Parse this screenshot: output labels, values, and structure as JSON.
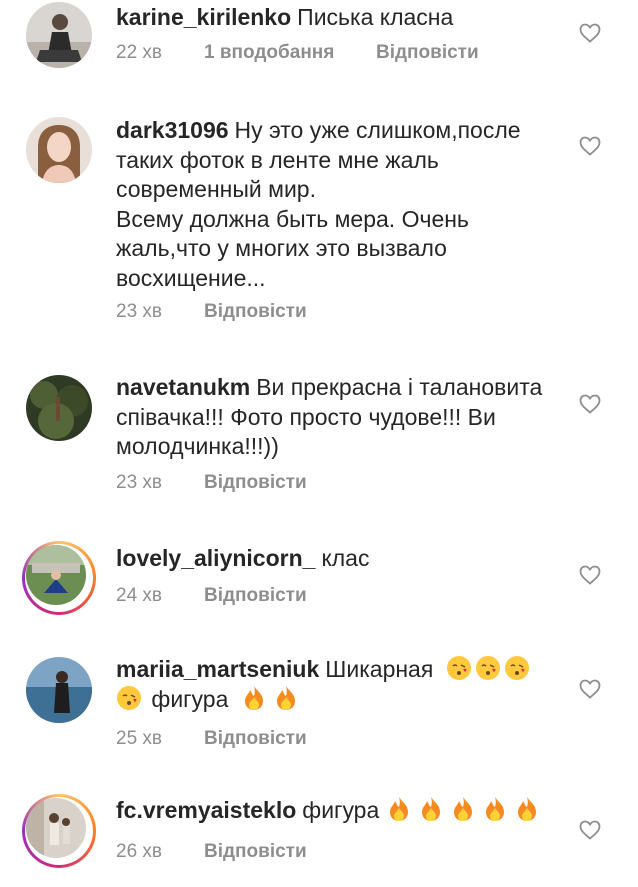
{
  "comments": [
    {
      "username": "karine_kirilenko",
      "text": "Писька класна",
      "time": "22 хв",
      "likes": "1 вподобання",
      "reply": "Відповісти",
      "avatar_icon": "avatar-photo-icon",
      "story_ring": false
    },
    {
      "username": "dark31096",
      "text": "Ну это уже слишком,после таких фоток в ленте мне жаль современный мир.",
      "text2": "Всему должна быть мера. Очень жаль,что у многих это вызвало восхищение...",
      "time": "23 хв",
      "reply": "Відповісти",
      "avatar_icon": "avatar-photo-icon",
      "story_ring": false
    },
    {
      "username": "navetanukm",
      "text": "Ви прекрасна і талановита співачка!!! Фото просто чудове!!! Ви молодчинка!!!))",
      "time": "23 хв",
      "reply": "Відповісти",
      "avatar_icon": "avatar-photo-icon",
      "story_ring": false
    },
    {
      "username": "lovely_aliynicorn_",
      "text": "клас",
      "time": "24 хв",
      "reply": "Відповісти",
      "avatar_icon": "avatar-photo-icon",
      "story_ring": true
    },
    {
      "username": "mariia_martseniuk",
      "text": "Шикарная",
      "text_after_emoji": "фигура",
      "emoji_kiss_count": 4,
      "emoji_fire_count": 2,
      "time": "25 хв",
      "reply": "Відповісти",
      "avatar_icon": "avatar-photo-icon",
      "story_ring": false
    },
    {
      "username": "fc.vremyaisteklo",
      "text": "фигура",
      "emoji_fire_count": 5,
      "time": "26 хв",
      "reply": "Відповісти",
      "avatar_icon": "avatar-photo-icon",
      "story_ring": true
    }
  ],
  "icons": {
    "like": "heart-outline-icon",
    "kiss": "face-blowing-kiss-emoji",
    "fire": "fire-emoji"
  },
  "colors": {
    "text": "#262626",
    "meta": "#8e8e8e",
    "heart_outline": "#8e8e8e",
    "story_ring_gradient": [
      "#fdc468",
      "#fa7e1e",
      "#d62976",
      "#962fbf"
    ]
  }
}
